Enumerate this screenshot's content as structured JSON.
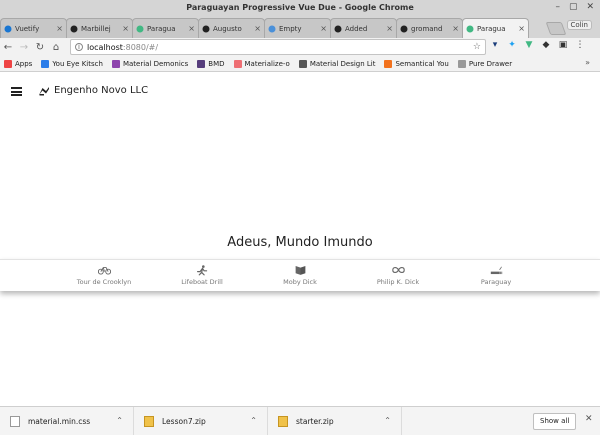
{
  "window": {
    "title": "Paraguayan Progressive Vue Due - Google Chrome",
    "profile": "Colin",
    "controls": [
      "–",
      "▢",
      "✕"
    ]
  },
  "tabs": [
    {
      "label": "Vuetify",
      "icon": "vuetify-icon",
      "color": "#1976d2",
      "active": false
    },
    {
      "label": "Marbillej",
      "icon": "github-icon",
      "color": "#222222",
      "active": false
    },
    {
      "label": "Paragua",
      "icon": "vue-icon",
      "color": "#41b883",
      "active": false
    },
    {
      "label": "Augusto",
      "icon": "github-icon",
      "color": "#222222",
      "active": false
    },
    {
      "label": "Empty",
      "icon": "doc-icon",
      "color": "#4a90d9",
      "active": false
    },
    {
      "label": "Added",
      "icon": "github-icon",
      "color": "#222222",
      "active": false
    },
    {
      "label": "gromand",
      "icon": "github-icon",
      "color": "#222222",
      "active": false
    },
    {
      "label": "Paragua",
      "icon": "vue-icon",
      "color": "#41b883",
      "active": true
    }
  ],
  "toolbar": {
    "url_host": "localhost",
    "url_rest": ":8080/#/"
  },
  "bookmarks": [
    {
      "label": "Apps",
      "icon": "apps-grid-icon",
      "color": "#e44"
    },
    {
      "label": "You Eye Kitsch",
      "icon": "spinner-icon",
      "color": "#2b7de9"
    },
    {
      "label": "Material Demonics",
      "icon": "material-icon",
      "color": "#8e44ad"
    },
    {
      "label": "BMD",
      "icon": "bootstrap-icon",
      "color": "#563d7c"
    },
    {
      "label": "Materialize-o",
      "icon": "materialize-icon",
      "color": "#ee6e73"
    },
    {
      "label": "Material Design Lit",
      "icon": "mdl-icon",
      "color": "#555555"
    },
    {
      "label": "Semantical You",
      "icon": "semantic-icon",
      "color": "#f2711c"
    },
    {
      "label": "Pure Drawer",
      "icon": "doc-icon",
      "color": "#999999"
    }
  ],
  "app": {
    "brand": "Engenho Novo LLC",
    "headline": "Adeus, Mundo Imundo",
    "nav": [
      {
        "label": "Tour de Crooklyn",
        "icon": "bicycle-icon"
      },
      {
        "label": "Lifeboat Drill",
        "icon": "runner-icon"
      },
      {
        "label": "Moby Dick",
        "icon": "book-icon"
      },
      {
        "label": "Philip K. Dick",
        "icon": "infinity-icon"
      },
      {
        "label": "Paraguay",
        "icon": "smoking-icon"
      }
    ]
  },
  "downloads": {
    "items": [
      {
        "name": "material.min.css",
        "kind": "file"
      },
      {
        "name": "Lesson7.zip",
        "kind": "zip"
      },
      {
        "name": "starter.zip",
        "kind": "zip"
      }
    ],
    "show_all": "Show all"
  }
}
